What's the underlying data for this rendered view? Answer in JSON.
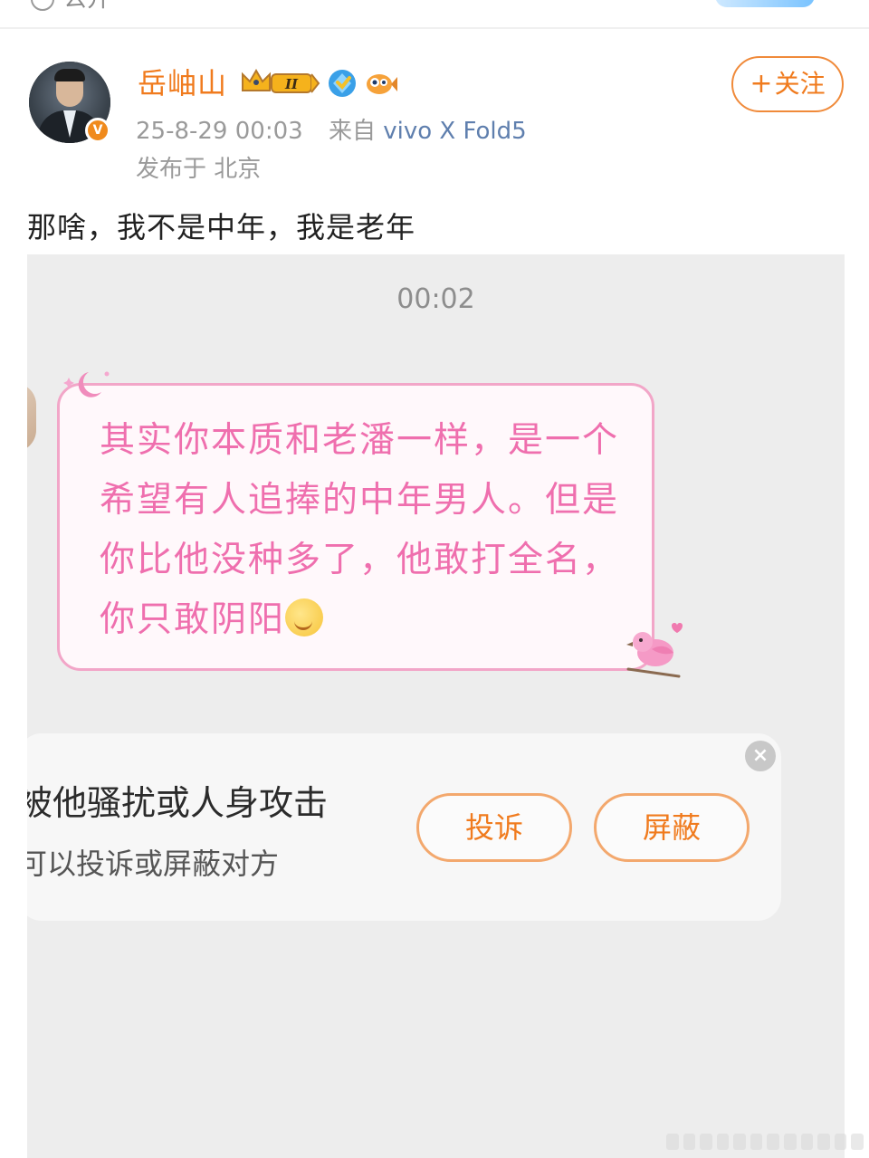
{
  "top_bar": {
    "text": "公开"
  },
  "post": {
    "author": {
      "name": "岳岫山",
      "verified_badge": "V",
      "level_badge": "II"
    },
    "follow_button": {
      "plus": "+",
      "label": "关注"
    },
    "meta": {
      "time": "25-8-29 00:03",
      "source_prefix": "来自",
      "device": "vivo X Fold5",
      "location": "发布于 北京"
    },
    "text": "那啥，我不是中年，我是老年"
  },
  "embedded_chat": {
    "timestamp": "00:02",
    "message": "其实你本质和老潘一样，是一个希望有人追捧的中年男人。但是你比他没种多了，他敢打全名，你只敢阴阳",
    "alert": {
      "title": "被他骚扰或人身攻击",
      "subtitle": "可以投诉或屏蔽对方",
      "report_label": "投诉",
      "block_label": "屏蔽",
      "close": "×"
    }
  },
  "icons": {
    "avatar": "person-avatar",
    "verified": "verified-v-icon",
    "crown": "crown-level-icon",
    "blue": "blue-diamond-badge-icon",
    "fish": "fish-badge-icon",
    "emoji": "smile-emoji-icon",
    "moon": "moon-sticker-icon",
    "bird": "pink-bird-sticker-icon",
    "close": "close-icon"
  },
  "colors": {
    "accent": "#f07b1e",
    "device_link": "#5f7fae",
    "bubble_text": "#ef6fae",
    "bubble_border": "#f2a6c8"
  }
}
